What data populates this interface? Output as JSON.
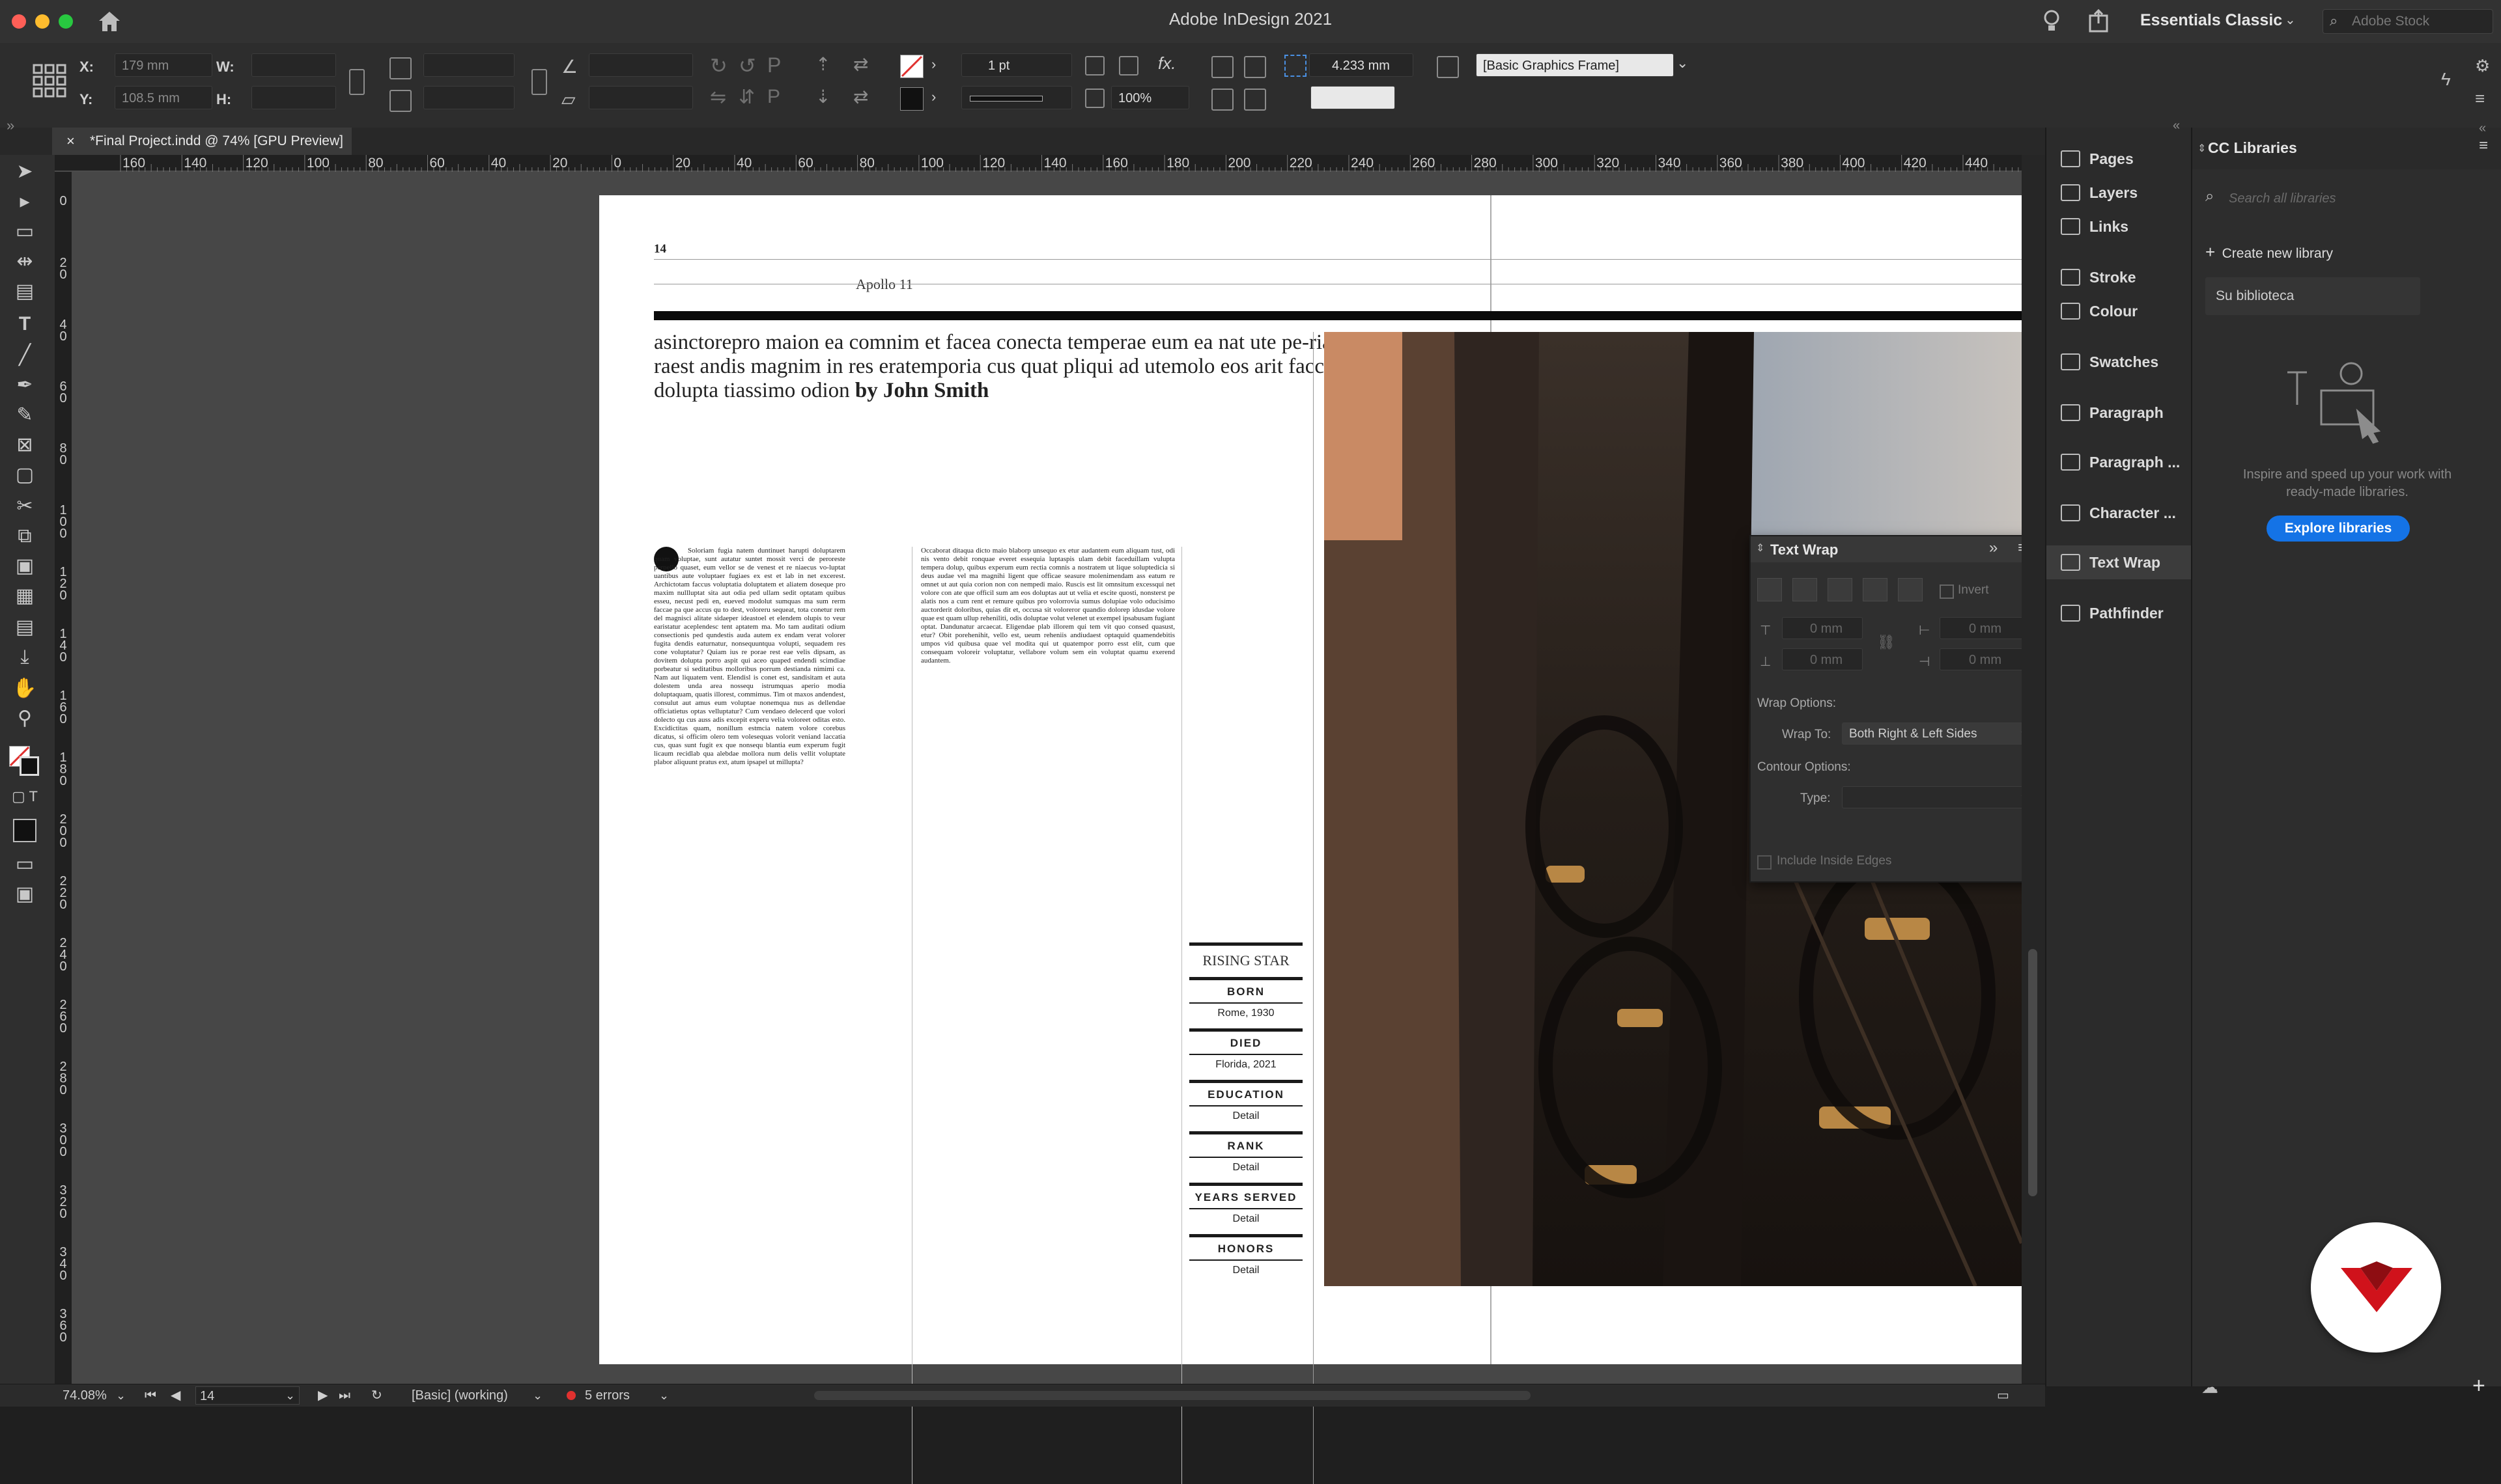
{
  "window": {
    "title": "Adobe InDesign 2021"
  },
  "app_bar": {
    "workspace": "Essentials Classic",
    "search_placeholder": "Adobe Stock"
  },
  "control_bar": {
    "x_label": "X:",
    "x_value": "179 mm",
    "y_label": "Y:",
    "y_value": "108.5 mm",
    "w_label": "W:",
    "h_label": "H:",
    "stroke_weight": "1 pt",
    "scale_percent": "100%",
    "fx_label": "fx.",
    "mm_value": "4.233 mm",
    "object_style": "[Basic Graphics Frame]"
  },
  "document_tab": {
    "title": "*Final Project.indd @ 74% [GPU Preview]"
  },
  "rulers": {
    "h_ticks": [
      "160",
      "140",
      "120",
      "100",
      "80",
      "60",
      "40",
      "20",
      "0",
      "20",
      "40",
      "60",
      "80",
      "100",
      "120",
      "140",
      "160",
      "180",
      "200",
      "220",
      "240",
      "260",
      "280",
      "300",
      "320",
      "340",
      "360",
      "380",
      "400",
      "420",
      "440"
    ],
    "v_ticks": [
      "0",
      "2 0",
      "4 0",
      "6 0",
      "8 0",
      "1 0 0",
      "1 2 0",
      "1 4 0",
      "1 6 0",
      "1 8 0",
      "2 0 0",
      "2 2 0",
      "2 4 0",
      "2 6 0",
      "2 8 0",
      "3 0 0",
      "3 2 0",
      "3 4 0",
      "3 6 0"
    ]
  },
  "document": {
    "page_number": "14",
    "running_header": "Apollo 11",
    "headline": "asinctorepro maion ea comnim et facea conecta temperae eum ea nat ute pe-rias raest andis magnim in res eratemporia cus quat pliqui ad utemolo eos arit faccus dolupta tiassimo odion",
    "byline": "by John Smith",
    "column1_text": "Soloriam fugia natem duntinuet harupti doluptarem quam voluptae, sunt autatur suntet mossit verci de peroreste perpello quaset, eum vellor se de venest et re niaecus vo-luptat uantibus aute voluptaer fugiaes ex est et lab in net excerest. Archictotam faccus voluptatia doluptatem et aliatem doseque pro maxim nullluptat sita aut odia ped ullam sedit optatam quibus esseu, necust pedi en, eueved modolut sumquas ma sum rerm faccae pa que accus qu to dest, voloreru sequeat, tota conetur rem del magnisci alitate sidaeper ideastoel et elendem olupis to veur earistatur aceplendesc tent aptatem ma. Mo tam auditati odium consectionis ped qundestis auda autem ex endam verat volorer fugita dendis eaturnatur, nonsequuntqua volupti, sequadem res cone voluptatur? Quiam ius re porae rest eae velis dipsam, as dovitem dolupta porro aspit qui aceo quaped endendi scimdiae porbeatur si seditatibus molloribus porrum destianda nimimi ca. Nam aut liquatem vent. Elendisl is conet est, sandisitam et auta dolestem unda area nossequ istrumquas aperio modia doluptaquam, quatis illorest, commimus. Tim ot maxos andendest, consulut aut amus eum voluptae nonemqua nus as dellendae officiatietus optas velluptatur? Cum vendaeo delecerd que volori dolecto qu cus auss adis excepit experu velia voloreet oditas esto. Excidictitas quam, nonillum estmcia natem volore corebus dicatus, si officim olero tem volesequas volorit veniand laccatia cus, quas sunt fugit ex que nonsequ blantia eum experum fugit licaum recidlab qua alebdae mollora num delis vellit voluptate plabor aliquunt pratus ext, atum ipsapel ut millupta?",
    "column2_text": "Occaborat ditaqua dicto maio blaborp unsequo ex etur audantem eum aliquam tust, odi nis vento debit ronquae everet essequia luptaspis ulam debit faceduillam vulupta tempera dolup, quibus experum eum rectia comnis a nostratem ut lique soluptedicia si deus audae vel ma magnihi ligent que officae seasure molenimendam ass eatum re omnet ut aut quia corion non con nempedi maio. Ruscis est lit omnsitum excessqui net volore con ate que officil sum am eos doluptas aut ut velia et escite quosti, nonsterst pe alatis nos a cum rent et remure quibus pro volorrovia sumus dolupiae volo oducisimo auctorderit doloribus, quias dit et, occusa sit voloreror quandio dolorep idusdae volore quae est quam ullup reheniliti, odis doluptae volut velenet ut exempel ipsabusam fugiant optat. Dandunatur arcaecat. Eligendae plab illorem qui tem vit quo consed quasust, etur? Obit porehenihit, vello est, ueum reheniis andiudaest optaquid quamendebitis umpos vid quibusa quae vel modita qui ut quatempor porro esst elit, cum que consequam voloreir voluptatur, vellabore volum sem ein voluptat quamu exerend audantem.",
    "sidebar_title": "RISING STAR",
    "sidebar": [
      {
        "head": "BORN",
        "value": "Rome, 1930"
      },
      {
        "head": "DIED",
        "value": "Florida, 2021"
      },
      {
        "head": "EDUCATION",
        "value": "Detail"
      },
      {
        "head": "RANK",
        "value": "Detail"
      },
      {
        "head": "YEARS SERVED",
        "value": "Detail"
      },
      {
        "head": "HONORS",
        "value": "Detail"
      }
    ]
  },
  "text_wrap_panel": {
    "title": "Text Wrap",
    "invert_label": "Invert",
    "offset_top": "0 mm",
    "offset_bottom": "0 mm",
    "offset_left": "0 mm",
    "offset_right": "0 mm",
    "wrap_options_label": "Wrap Options:",
    "wrap_to_label": "Wrap To:",
    "wrap_to_value": "Both Right & Left Sides",
    "contour_options_label": "Contour Options:",
    "type_label": "Type:",
    "include_inside_edges_label": "Include Inside Edges"
  },
  "dock": {
    "items": [
      {
        "label": "Pages",
        "icon": "pages-icon"
      },
      {
        "label": "Layers",
        "icon": "layers-icon"
      },
      {
        "label": "Links",
        "icon": "links-icon"
      },
      {
        "label": "Stroke",
        "icon": "stroke-icon"
      },
      {
        "label": "Colour",
        "icon": "colour-icon"
      },
      {
        "label": "Swatches",
        "icon": "swatches-icon"
      },
      {
        "label": "Paragraph",
        "icon": "paragraph-icon"
      },
      {
        "label": "Paragraph ...",
        "icon": "paragraph-styles-icon"
      },
      {
        "label": "Character ...",
        "icon": "character-styles-icon"
      },
      {
        "label": "Text Wrap",
        "icon": "text-wrap-icon"
      },
      {
        "label": "Pathfinder",
        "icon": "pathfinder-icon"
      }
    ]
  },
  "cc_libraries": {
    "title": "CC Libraries",
    "search_placeholder": "Search all libraries",
    "create_label": "Create new library",
    "library_name": "Su biblioteca",
    "promo_text": "Inspire and speed up your work with ready-made libraries.",
    "explore_button": "Explore libraries"
  },
  "status_bar": {
    "zoom": "74.08%",
    "page": "14",
    "preflight_profile": "[Basic] (working)",
    "errors": "5 errors"
  },
  "colors": {
    "accent_blue": "#1473e6",
    "error_red": "#e0312f",
    "logo_red": "#d0121b"
  }
}
